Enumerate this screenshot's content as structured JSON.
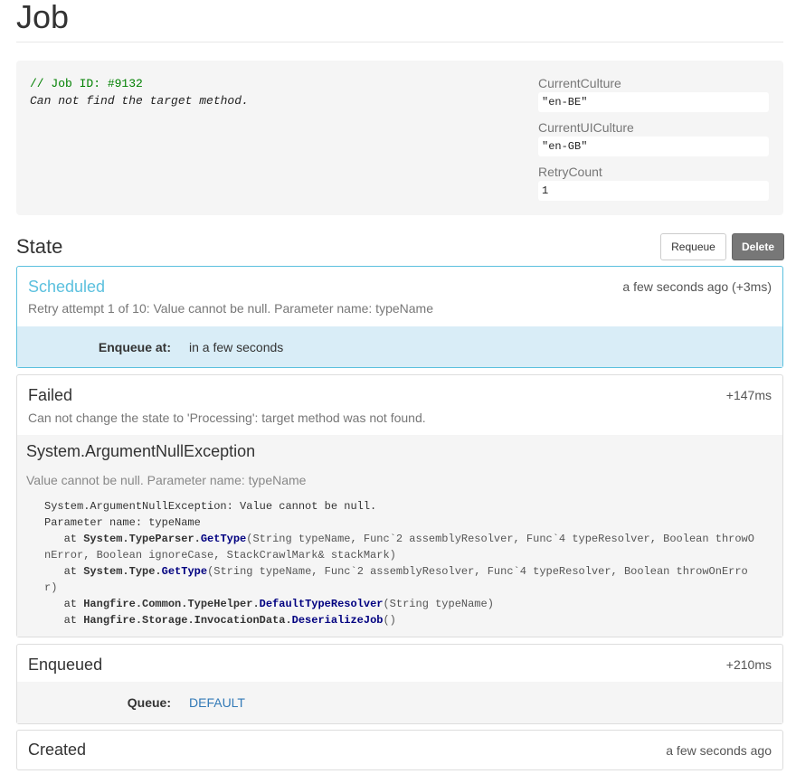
{
  "page": {
    "title": "Job"
  },
  "job": {
    "id_comment": "// Job ID: #9132",
    "message": "Can not find the target method.",
    "params": [
      {
        "label": "CurrentCulture",
        "value": "\"en-BE\""
      },
      {
        "label": "CurrentUICulture",
        "value": "\"en-GB\""
      },
      {
        "label": "RetryCount",
        "value": "1"
      }
    ]
  },
  "state": {
    "title": "State",
    "requeue_label": "Requeue",
    "delete_label": "Delete"
  },
  "scheduled": {
    "title": "Scheduled",
    "time": "a few seconds ago (+3ms)",
    "desc": "Retry attempt 1 of 10: Value cannot be null. Parameter name: typeName",
    "key": "Enqueue at:",
    "value": "in a few seconds"
  },
  "failed": {
    "title": "Failed",
    "time": "+147ms",
    "desc": "Can not change the state to 'Processing': target method was not found.",
    "exception_type": "System.ArgumentNullException",
    "exception_message": "Value cannot be null. Parameter name: typeName",
    "stack": {
      "line1": "System.ArgumentNullException: Value cannot be null.",
      "line2": "Parameter name: typeName",
      "at": "at",
      "f1_type": "System.TypeParser.",
      "f1_method": "GetType",
      "f1_args": "(String typeName, Func`2 assemblyResolver, Func`4 typeResolver, Boolean throwOnError, Boolean ignoreCase, StackCrawlMark& stackMark)",
      "f2_type": "System.Type.",
      "f2_method": "GetType",
      "f2_args": "(String typeName, Func`2 assemblyResolver, Func`4 typeResolver, Boolean throwOnError)",
      "f3_type": "Hangfire.Common.TypeHelper.",
      "f3_method": "DefaultTypeResolver",
      "f3_args": "(String typeName)",
      "f4_type": "Hangfire.Storage.InvocationData.",
      "f4_method": "DeserializeJob",
      "f4_args": "()"
    }
  },
  "enqueued": {
    "title": "Enqueued",
    "time": "+210ms",
    "key": "Queue:",
    "value": "DEFAULT"
  },
  "created": {
    "title": "Created",
    "time": "a few seconds ago"
  }
}
